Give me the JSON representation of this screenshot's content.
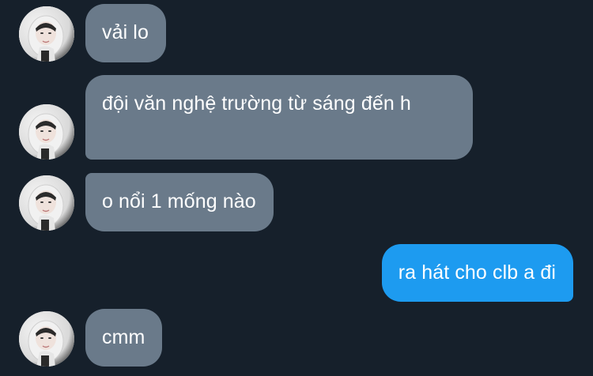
{
  "messages": [
    {
      "direction": "incoming",
      "text": "vải lo"
    },
    {
      "direction": "incoming",
      "text": "đội văn nghệ trường từ sáng đến h"
    },
    {
      "direction": "incoming",
      "text": "o nổi 1 mống nào"
    },
    {
      "direction": "outgoing",
      "text": "ra hát cho clb a đi"
    },
    {
      "direction": "incoming",
      "text": "cmm"
    }
  ],
  "colors": {
    "background": "#16202b",
    "incoming_bubble": "#6a7a8a",
    "outgoing_bubble": "#1d9bf0",
    "text": "#ffffff"
  },
  "icons": {
    "avatar": "contact-avatar-photo"
  }
}
